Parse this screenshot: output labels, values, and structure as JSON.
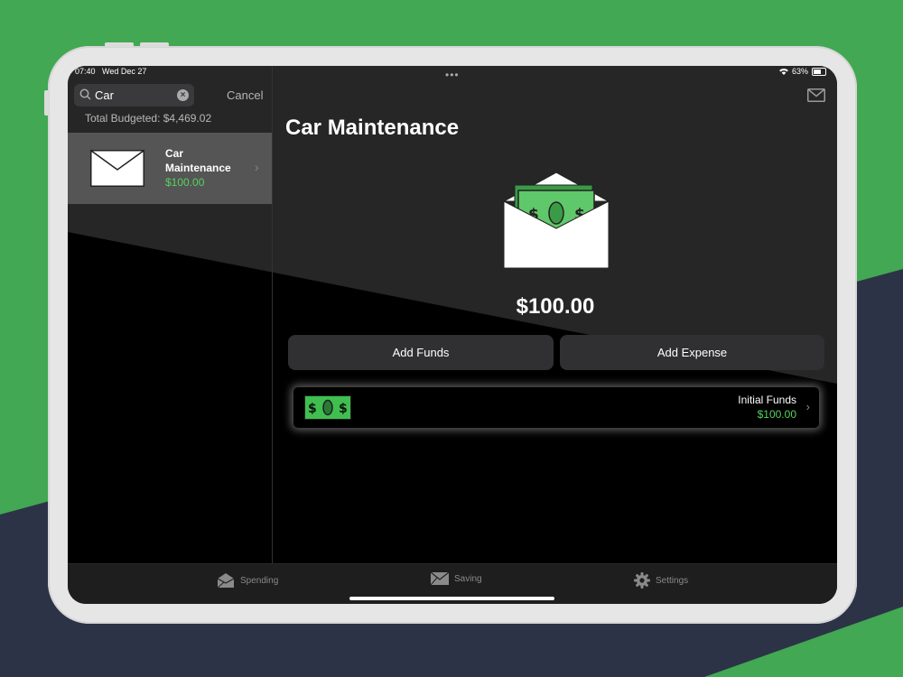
{
  "statusbar": {
    "time": "07:40",
    "date": "Wed Dec 27",
    "battery": "63%",
    "wifi_icon": "wifi-icon"
  },
  "sidebar": {
    "search": {
      "value": "Car",
      "cancel_label": "Cancel"
    },
    "total_budgeted": "Total Budgeted: $4,469.02",
    "items": [
      {
        "name": "Car Maintenance",
        "amount": "$100.00"
      }
    ]
  },
  "detail": {
    "title": "Car Maintenance",
    "amount": "$100.00",
    "add_funds_label": "Add Funds",
    "add_expense_label": "Add Expense",
    "transactions": [
      {
        "name": "Initial Funds",
        "amount": "$100.00"
      }
    ]
  },
  "tabbar": {
    "tabs": [
      {
        "label": "Spending",
        "icon": "open-envelope-icon"
      },
      {
        "label": "Saving",
        "icon": "envelope-icon"
      },
      {
        "label": "Settings",
        "icon": "gear-icon"
      }
    ]
  },
  "colors": {
    "accent_green": "#55d35d",
    "background_green": "#42a853",
    "background_navy": "#2c3347"
  }
}
